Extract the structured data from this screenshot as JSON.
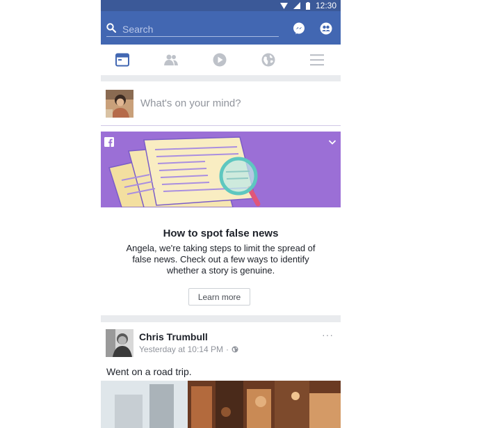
{
  "status_bar": {
    "time": "12:30"
  },
  "header": {
    "search_placeholder": "Search"
  },
  "composer": {
    "prompt": "What's on your mind?"
  },
  "news_card": {
    "title": "How to spot false news",
    "body": "Angela, we're taking steps to limit the spread of false news. Check out a few ways to identify whether a story is genuine.",
    "button_label": "Learn more"
  },
  "post": {
    "author": "Chris Trumbull",
    "timestamp": "Yesterday at 10:14 PM",
    "separator": "·",
    "more": "···",
    "text": "Went on a road trip."
  },
  "colors": {
    "status_bar": "#3b5998",
    "header": "#4267b2",
    "banner": "#9b6fd6",
    "active_tab": "#4267b2",
    "inactive_tab": "#bec2c9"
  }
}
